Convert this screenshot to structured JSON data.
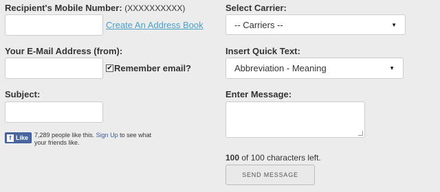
{
  "left": {
    "recipient_label": "Recipient's Mobile Number:",
    "recipient_hint": "(XXXXXXXXXX)",
    "recipient_value": "",
    "address_book_link": "Create An Address Book",
    "email_label": "Your E-Mail Address (from):",
    "email_value": "",
    "remember_label": "Remember email?",
    "remember_checked": true,
    "remember_mark": "✔",
    "subject_label": "Subject:",
    "subject_value": ""
  },
  "facebook": {
    "like_icon": "f",
    "like_label": "Like",
    "text_before": "7,289 people like this.",
    "signup_link": "Sign Up",
    "text_after": "to see what your friends like."
  },
  "right": {
    "carrier_label": "Select Carrier:",
    "carrier_selected": "-- Carriers --",
    "quicktext_label": "Insert Quick Text:",
    "quicktext_selected": "Abbreviation - Meaning",
    "message_label": "Enter Message:",
    "message_value": "",
    "chars_remaining": "100",
    "chars_suffix": "of 100 characters left.",
    "send_button": "SEND MESSAGE"
  },
  "icons": {
    "dropdown_arrow": "▼"
  }
}
